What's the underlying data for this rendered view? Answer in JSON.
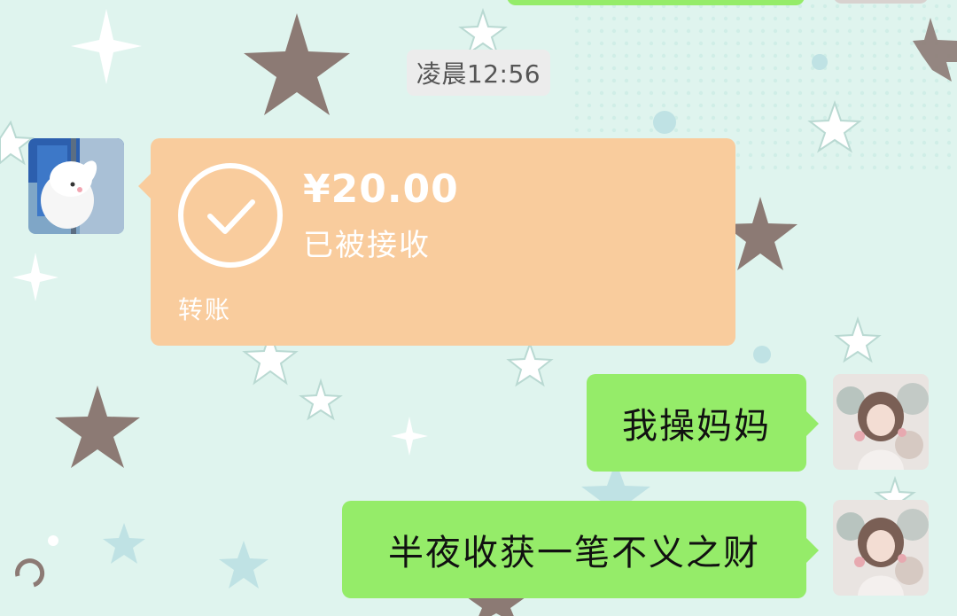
{
  "timestamp": "凌晨12:56",
  "transfer": {
    "amount": "¥20.00",
    "status": "已被接收",
    "label": "转账"
  },
  "messages": [
    {
      "side": "right",
      "text": "我操妈妈"
    },
    {
      "side": "right",
      "text": "半夜收获一笔不义之财"
    }
  ],
  "colors": {
    "background": "#dff4ee",
    "sent_bubble": "#95ec69",
    "transfer_card": "#f9cc9d",
    "timestamp_chip": "#ececec",
    "star_dark": "#8c7a74"
  }
}
